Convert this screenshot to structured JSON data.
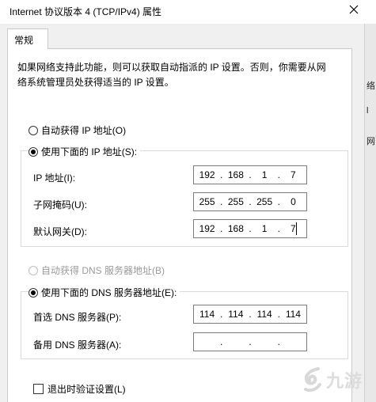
{
  "window": {
    "title": "Internet 协议版本 4 (TCP/IPv4) 属性",
    "close_glyph": "✕"
  },
  "tab": {
    "label": "常规"
  },
  "description": {
    "line1": "如果网络支持此功能，则可以获取自动指派的 IP 设置。否则，你需要从网",
    "line2": "络系统管理员处获得适当的 IP 设置。"
  },
  "ip_mode": {
    "auto_label": "自动获得 IP 地址(O)",
    "manual_label": "使用下面的 IP 地址(S):",
    "selected": "manual"
  },
  "ip_fields": [
    {
      "label": "IP 地址(I):",
      "segments": [
        "192",
        "168",
        "1",
        "7"
      ]
    },
    {
      "label": "子网掩码(U):",
      "segments": [
        "255",
        "255",
        "255",
        "0"
      ]
    },
    {
      "label": "默认网关(D):",
      "segments": [
        "192",
        "168",
        "1",
        "7"
      ]
    }
  ],
  "dns_mode": {
    "auto_label": "自动获得 DNS 服务器地址(B)",
    "manual_label": "使用下面的 DNS 服务器地址(E):",
    "selected": "manual",
    "auto_disabled": true
  },
  "dns_fields": [
    {
      "label": "首选 DNS 服务器(P):",
      "segments": [
        "114",
        "114",
        "114",
        "114"
      ]
    },
    {
      "label": "备用 DNS 服务器(A):",
      "segments": [
        "",
        "",
        "",
        ""
      ]
    }
  ],
  "validate_on_exit": {
    "label": "退出时验证设置(L)",
    "checked": false
  },
  "right_strip_chars": [
    "络",
    "l",
    "网"
  ],
  "watermark": {
    "text": "九游"
  }
}
